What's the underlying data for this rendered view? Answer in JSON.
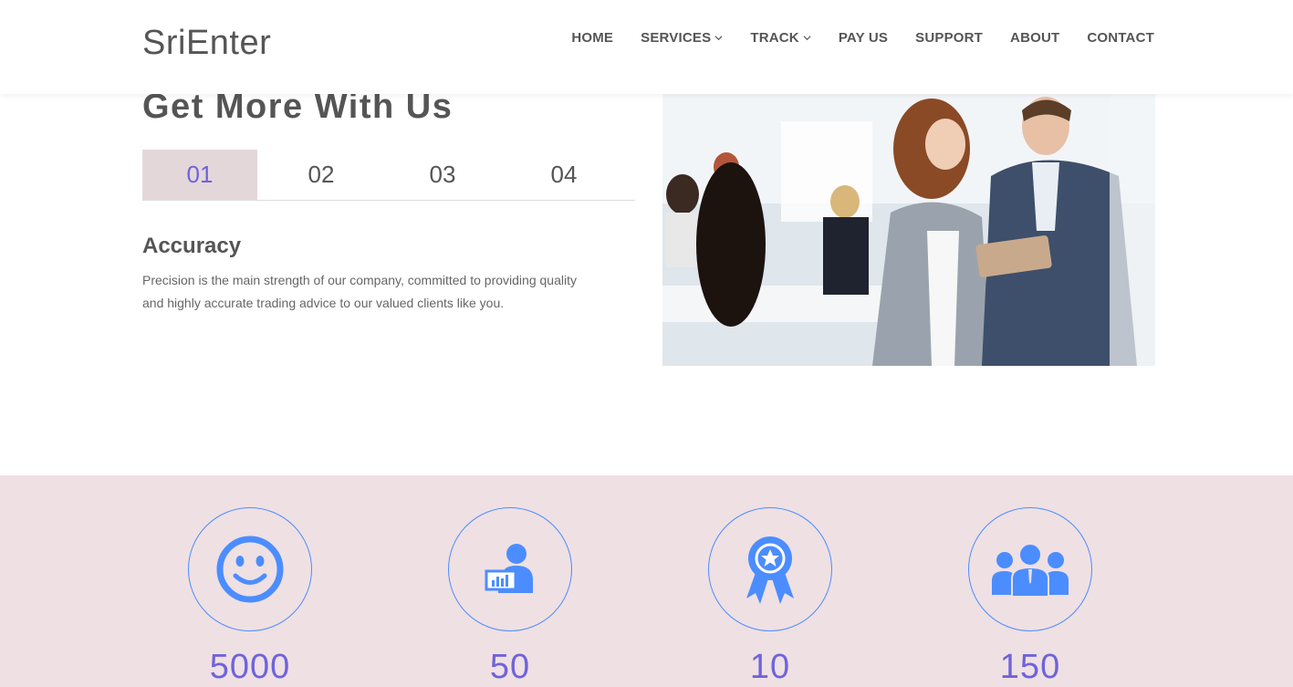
{
  "brand": "SriEnter",
  "nav": {
    "home": "HOME",
    "services": "SERVICES",
    "track": "TRACK",
    "pay_us": "PAY US",
    "support": "SUPPORT",
    "about": "ABOUT",
    "contact": "CONTACT"
  },
  "intro": {
    "title": "Get More With Us",
    "tabs": [
      "01",
      "02",
      "03",
      "04"
    ],
    "active_tab": "01",
    "feature_title": "Accuracy",
    "feature_text": "Precision is the main strength of our company, committed to providing quality and highly accurate trading advice to our valued clients like you."
  },
  "stats": [
    {
      "icon": "smiley-icon",
      "value": "5000"
    },
    {
      "icon": "presenter-icon",
      "value": "50"
    },
    {
      "icon": "award-ribbon-icon",
      "value": "10"
    },
    {
      "icon": "team-icon",
      "value": "150"
    }
  ],
  "colors": {
    "accent": "#6f63db",
    "icon_blue": "#4b8dff",
    "stats_bg": "#efe0e3",
    "active_tab_bg": "#e4d7da"
  }
}
